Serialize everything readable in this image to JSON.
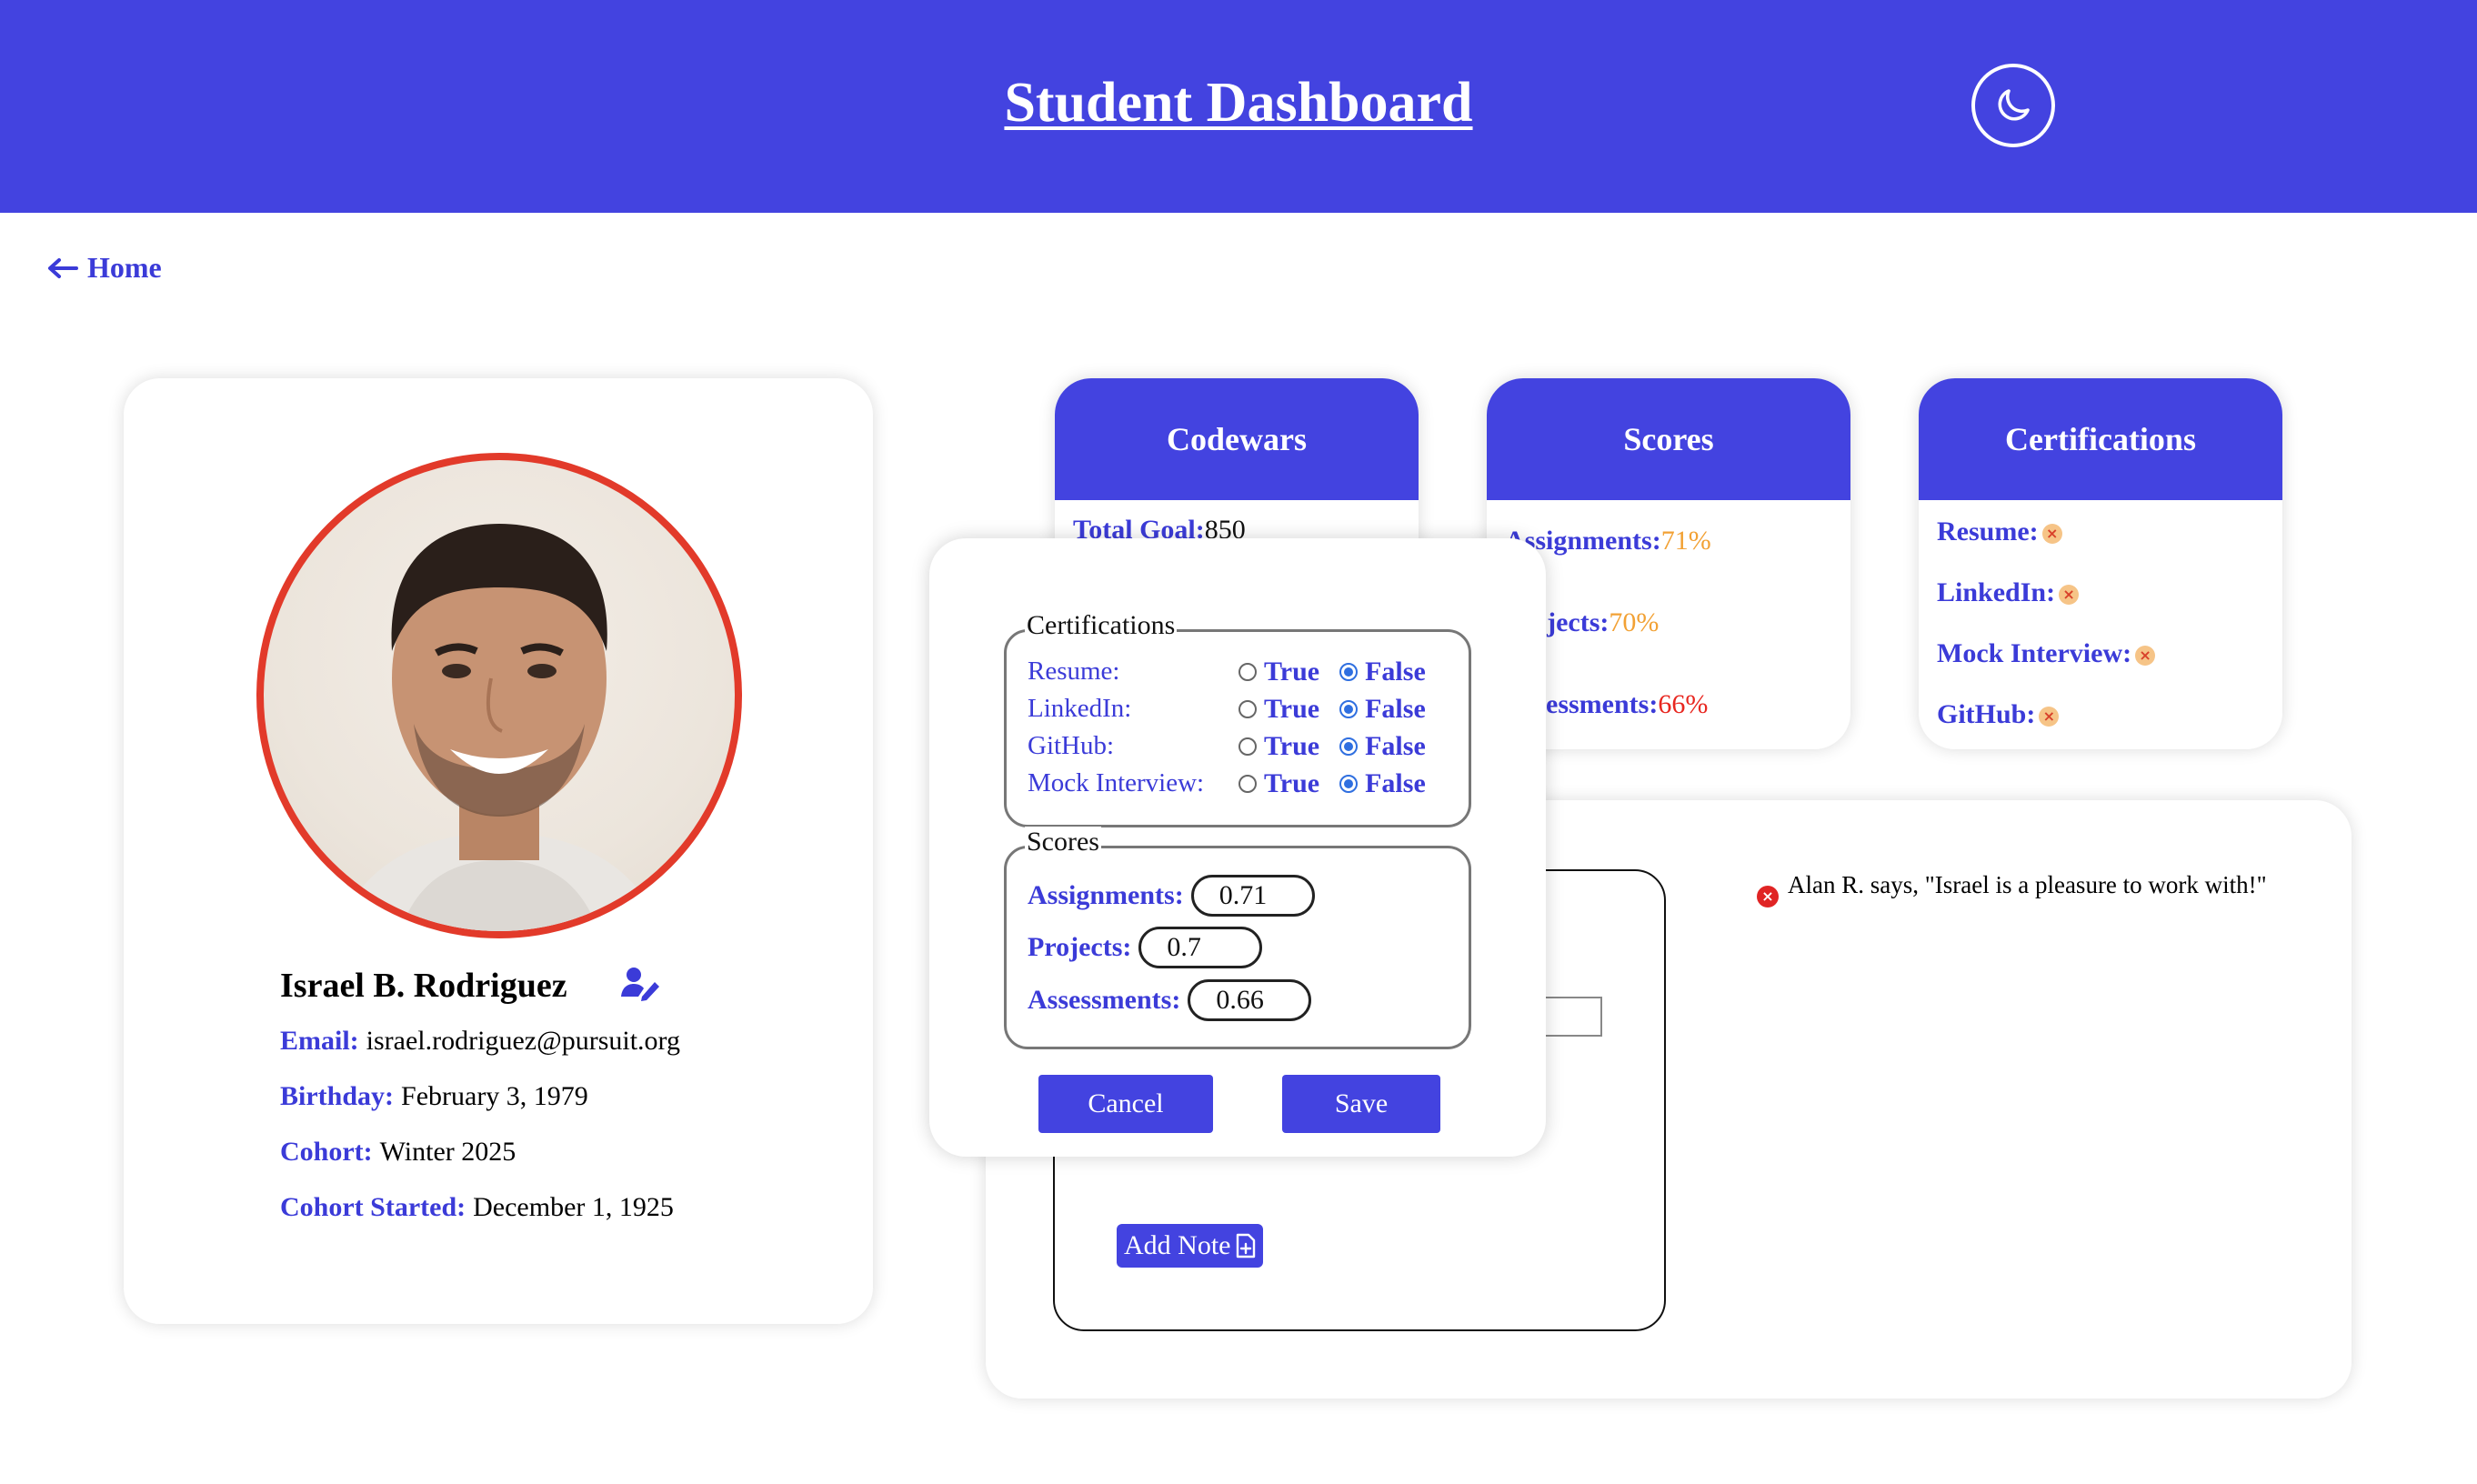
{
  "header": {
    "title": "Student Dashboard",
    "theme_icon": "moon-icon"
  },
  "nav": {
    "home_label": "Home",
    "home_icon": "arrow-left-icon"
  },
  "profile": {
    "name": "Israel B. Rodriguez",
    "edit_icon": "user-edit-icon",
    "email_label": "Email:",
    "email": "israel.rodriguez@pursuit.org",
    "birthday_label": "Birthday:",
    "birthday": "February 3, 1979",
    "cohort_label": "Cohort:",
    "cohort": "Winter 2025",
    "cohort_started_label": "Cohort Started:",
    "cohort_started": "December 1, 1925"
  },
  "codewars": {
    "title": "Codewars",
    "total_goal_label": "Total Goal:",
    "total_goal": "850"
  },
  "scores_card": {
    "title": "Scores",
    "assignments_label": "Assignments:",
    "assignments": "71%",
    "projects_label": "Projects:",
    "projects": "70%",
    "assessments_label": "Assessments:",
    "assessments": "66%"
  },
  "certifications_card": {
    "title": "Certifications",
    "items": [
      {
        "label": "Resume:",
        "status_icon": "x-icon"
      },
      {
        "label": "LinkedIn:",
        "status_icon": "x-icon"
      },
      {
        "label": "Mock Interview:",
        "status_icon": "x-icon"
      },
      {
        "label": "GitHub:",
        "status_icon": "x-icon"
      }
    ]
  },
  "notes": {
    "add_label": "Add Note",
    "add_icon": "file-plus-icon",
    "items": [
      {
        "text": "Alan R. says, \"Israel is a pleasure to work with!\""
      }
    ]
  },
  "edit_modal": {
    "cert_legend": "Certifications",
    "true_label": "True",
    "false_label": "False",
    "certs": [
      {
        "label": "Resume:",
        "value": "False"
      },
      {
        "label": "LinkedIn:",
        "value": "False"
      },
      {
        "label": "GitHub:",
        "value": "False"
      },
      {
        "label": "Mock Interview:",
        "value": "False"
      }
    ],
    "scores_legend": "Scores",
    "scores": [
      {
        "label": "Assignments:",
        "value": "0.71"
      },
      {
        "label": "Projects:",
        "value": "0.7"
      },
      {
        "label": "Assessments:",
        "value": "0.66"
      }
    ],
    "cancel_label": "Cancel",
    "save_label": "Save"
  },
  "colors": {
    "brand": "#4343e0",
    "avatar_ring": "#e23a2a",
    "score_warning": "#f2a134",
    "score_danger": "#e8261f"
  }
}
